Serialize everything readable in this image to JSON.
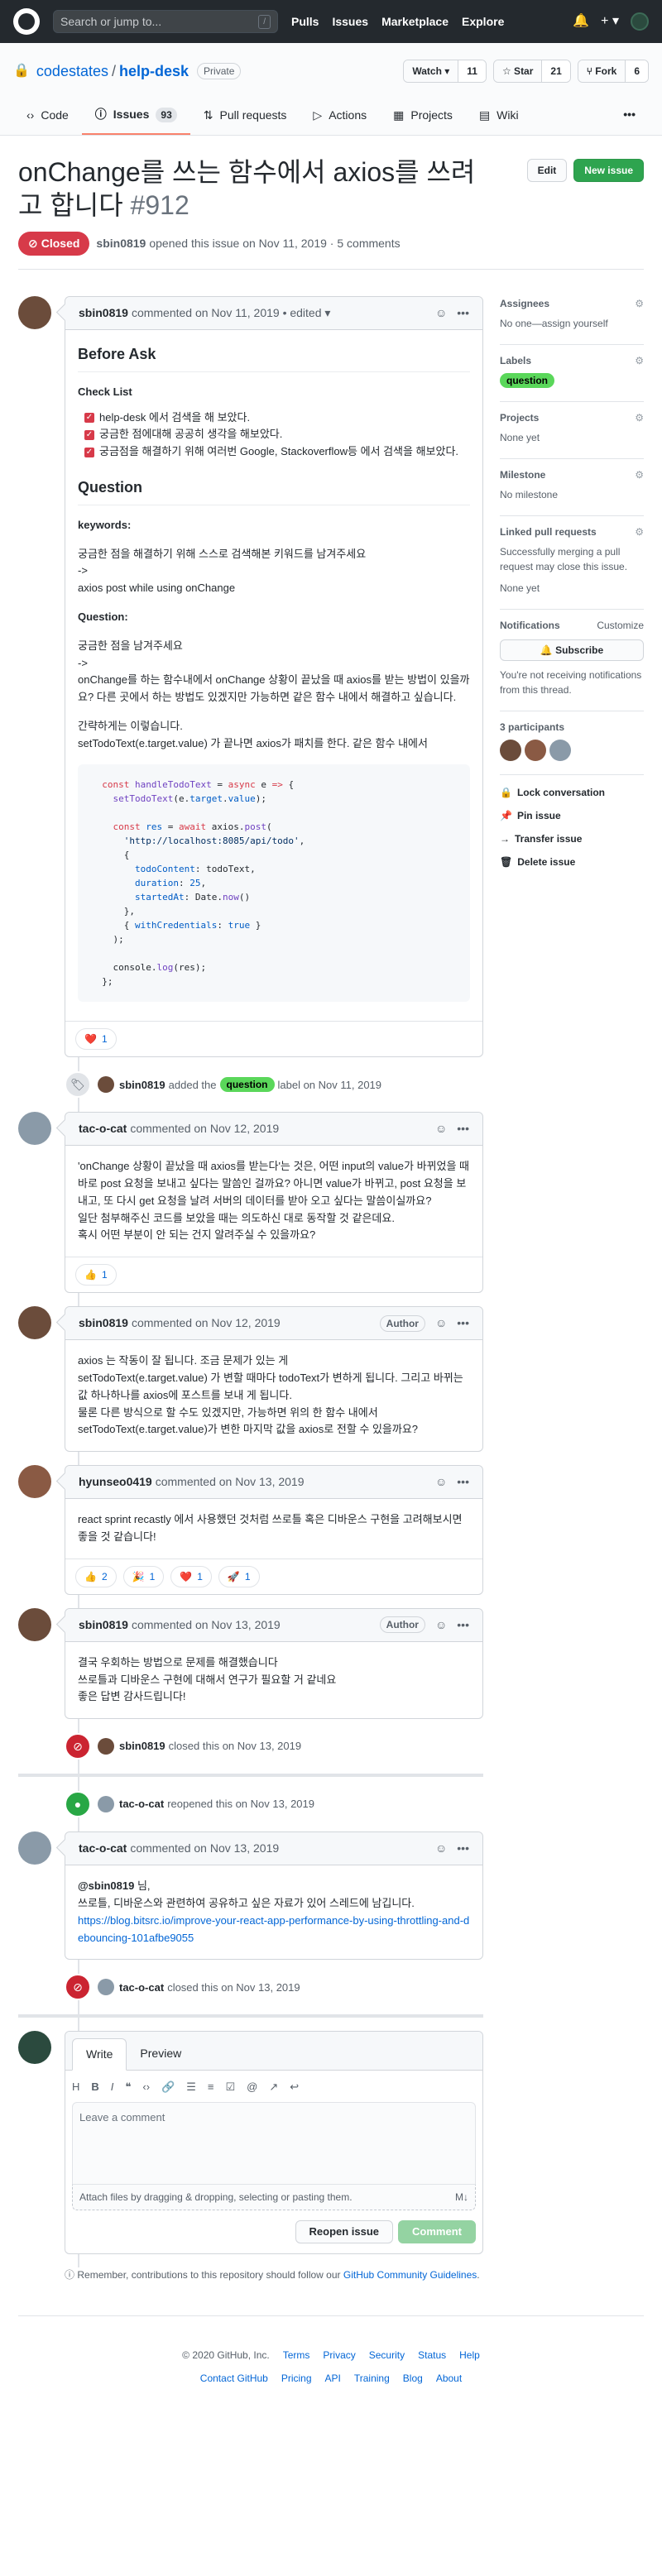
{
  "header": {
    "search_placeholder": "Search or jump to...",
    "slash": "/",
    "nav": [
      "Pulls",
      "Issues",
      "Marketplace",
      "Explore"
    ],
    "bell": "🔔",
    "plus": "+ ▾"
  },
  "repo": {
    "owner": "codestates",
    "name": "help-desk",
    "visibility": "Private",
    "watch": "Watch ▾",
    "watch_count": "11",
    "star": "☆ Star",
    "star_count": "21",
    "fork": "⑂ Fork",
    "fork_count": "6"
  },
  "tabs": [
    {
      "icon": "‹›",
      "label": "Code"
    },
    {
      "icon": "ⓘ",
      "label": "Issues",
      "count": "93"
    },
    {
      "icon": "⇅",
      "label": "Pull requests"
    },
    {
      "icon": "▷",
      "label": "Actions"
    },
    {
      "icon": "▦",
      "label": "Projects"
    },
    {
      "icon": "▤",
      "label": "Wiki"
    }
  ],
  "tabs_more": "•••",
  "issue": {
    "title": "onChange를 쓰는 함수에서 axios를 쓰려고 합니다",
    "number": "#912",
    "edit": "Edit",
    "new_issue": "New issue",
    "state": "Closed",
    "author": "sbin0819",
    "meta": "opened this issue on Nov 11, 2019 · 5 comments"
  },
  "first_comment": {
    "author": "sbin0819",
    "meta": "commented on Nov 11, 2019 • edited ▾",
    "h_before": "Before Ask",
    "h_check": "Check List",
    "checks": [
      "help-desk 에서 검색을 해 보았다.",
      "궁금한 점에대해 공공히 생각을 해보았다.",
      "궁금점을 해결하기 위해 여러번 Google, Stackoverflow등 에서 검색을 해보았다."
    ],
    "h_question": "Question",
    "h_keywords": "keywords:",
    "kw1": "궁금한 점을 해결하기 위해 스스로 검색해본 키워드를 남겨주세요",
    "kw2": "->",
    "kw3": "axios post while using onChange",
    "h_q": "Question:",
    "q1": "궁금한 점을 남겨주세요",
    "q2": "->",
    "q3": "onChange를 하는 함수내에서 onChange 상황이 끝났을 때 axios를 받는 방법이 있을까요? 다른 곳에서 하는 방법도 있겠지만 가능하면 같은 함수 내에서 해결하고 싶습니다.",
    "q4": "간략하게는 이렇습니다.",
    "q5": "setTodoText(e.target.value) 가 끝나면 axios가 패치를 한다. 같은 함수 내에서",
    "reaction_emoji": "❤️",
    "reaction_count": "1"
  },
  "label_event": {
    "actor": "sbin0819",
    "pre": "added the",
    "label": "question",
    "post": "label on Nov 11, 2019"
  },
  "comments": [
    {
      "author": "tac-o-cat",
      "meta": "commented on Nov 12, 2019",
      "badge": "",
      "lines": [
        "'onChange 상황이 끝났을 때 axios를 받는다'는 것은, 어떤 input의 value가 바뀌었을 때 바로 post 요청을 보내고 싶다는 말씀인 걸까요? 아니면 value가 바뀌고, post 요청을 보내고, 또 다시 get 요청을 날려 서버의 데이터를 받아 오고 싶다는 말씀이실까요?",
        "일단 첨부해주신 코드를 보았을 때는 의도하신 대로 동작할 것 같은데요.",
        "혹시 어떤 부분이 안 되는 건지 알려주실 수 있을까요?"
      ],
      "reactions": [
        {
          "emoji": "👍",
          "count": "1"
        }
      ]
    },
    {
      "author": "sbin0819",
      "meta": "commented on Nov 12, 2019",
      "badge": "Author",
      "lines": [
        "axios 는 작동이 잘 됩니다. 조금 문제가 있는 게",
        "setTodoText(e.target.value) 가 변할 때마다 todoText가 변하게 됩니다. 그리고 바뀌는 값 하나하나를 axios에 포스트를 보내 게 됩니다.",
        "물론 다른 방식으로 할 수도 있겠지만, 가능하면 위의 한 함수 내에서",
        "setTodoText(e.target.value)가 변한 마지막 값을 axios로 전할 수 있을까요?"
      ],
      "reactions": []
    },
    {
      "author": "hyunseo0419",
      "meta": "commented on Nov 13, 2019",
      "badge": "",
      "lines": [
        "react sprint recastly 에서 사용했던 것처럼 쓰로틀 혹은 디바운스 구현을 고려해보시면 좋을 것 같습니다!"
      ],
      "reactions": [
        {
          "emoji": "👍",
          "count": "2"
        },
        {
          "emoji": "🎉",
          "count": "1"
        },
        {
          "emoji": "❤️",
          "count": "1"
        },
        {
          "emoji": "🚀",
          "count": "1"
        }
      ]
    },
    {
      "author": "sbin0819",
      "meta": "commented on Nov 13, 2019",
      "badge": "Author",
      "lines": [
        "결국 우회하는 방법으로 문제를 해결했습니다",
        "쓰로틀과 디바운스 구현에 대해서 연구가 필요할 거 같네요",
        "좋은 답변 감사드립니다!"
      ],
      "reactions": []
    }
  ],
  "events": {
    "closed1": {
      "actor": "sbin0819",
      "text": "closed this on Nov 13, 2019"
    },
    "reopened": {
      "actor": "tac-o-cat",
      "text": "reopened this on Nov 13, 2019"
    },
    "closed2": {
      "actor": "tac-o-cat",
      "text": "closed this on Nov 13, 2019"
    }
  },
  "last_comment": {
    "author": "tac-o-cat",
    "meta": "commented on Nov 13, 2019",
    "mention": "@sbin0819",
    "l1": " 님,",
    "l2": "쓰로틀, 디바운스와 관련하여 공유하고 싶은 자료가 있어 스레드에 남깁니다.",
    "link": "https://blog.bitsrc.io/improve-your-react-app-performance-by-using-throttling-and-debouncing-101afbe9055"
  },
  "editor": {
    "write": "Write",
    "preview": "Preview",
    "placeholder": "Leave a comment",
    "attach": "Attach files by dragging & dropping, selecting or pasting them.",
    "md": "M↓",
    "reopen": "Reopen issue",
    "comment": "Comment",
    "note_pre": "Remember, contributions to this repository should follow our ",
    "note_link": "GitHub Community Guidelines",
    "note_post": "."
  },
  "sidebar": {
    "assignees": "Assignees",
    "assignees_val": "No one—assign yourself",
    "labels": "Labels",
    "label_val": "question",
    "projects": "Projects",
    "projects_val": "None yet",
    "milestone": "Milestone",
    "milestone_val": "No milestone",
    "linked": "Linked pull requests",
    "linked_desc": "Successfully merging a pull request may close this issue.",
    "linked_val": "None yet",
    "notifications": "Notifications",
    "customize": "Customize",
    "subscribe": "🔔 Subscribe",
    "notif_desc": "You're not receiving notifications from this thread.",
    "participants": "3 participants",
    "lock": "Lock conversation",
    "pin": "Pin issue",
    "transfer": "Transfer issue",
    "delete": "Delete issue",
    "gear": "⚙"
  },
  "footer": {
    "copyright": "© 2020 GitHub, Inc.",
    "row1": [
      "Terms",
      "Privacy",
      "Security",
      "Status",
      "Help"
    ],
    "row2": [
      "Contact GitHub",
      "Pricing",
      "API",
      "Training",
      "Blog",
      "About"
    ]
  },
  "colors": {
    "accent": "#0366d6",
    "closed": "#d73a49",
    "green": "#2ea44f",
    "label": "#5ad75a"
  }
}
